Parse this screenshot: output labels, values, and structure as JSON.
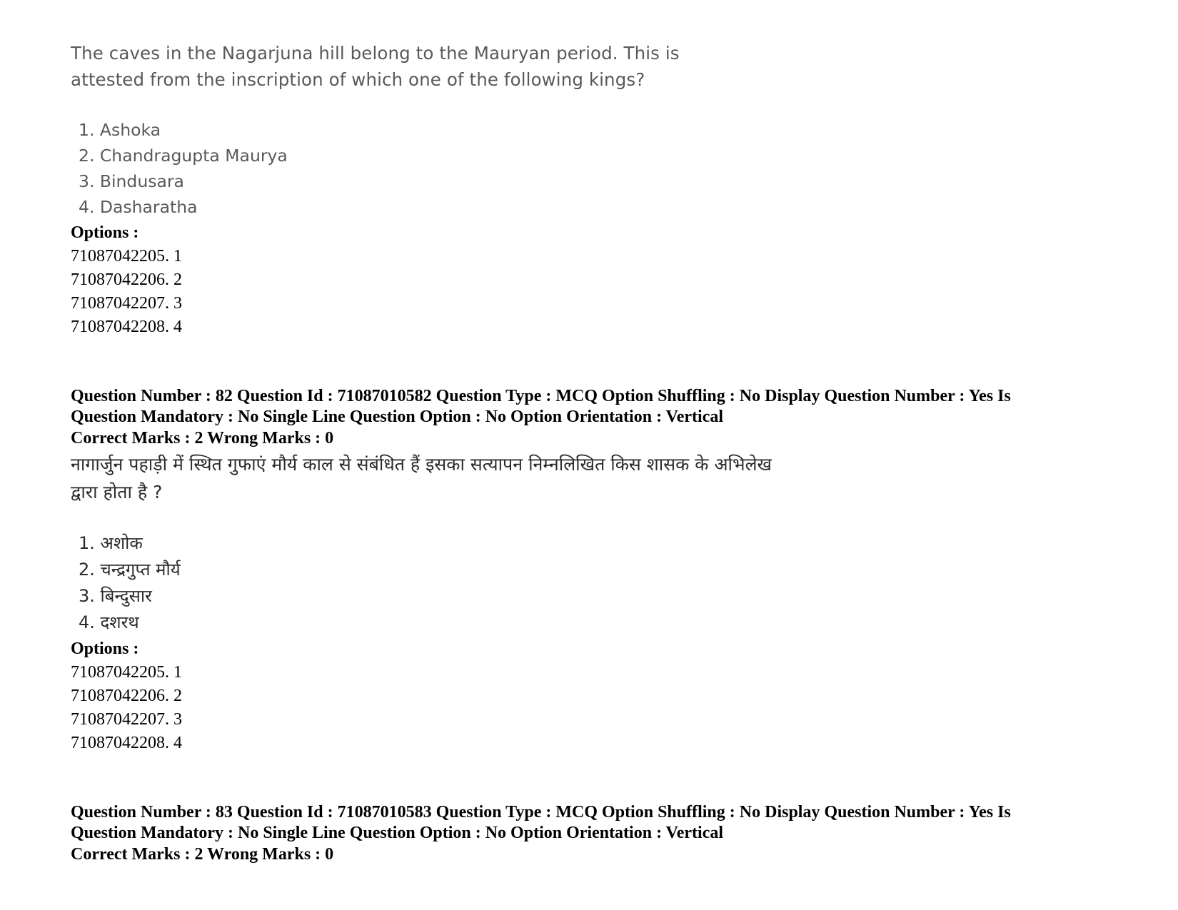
{
  "document": {
    "page_background": "#ffffff",
    "text_color_body": "#58595b",
    "text_color_meta": "#000000"
  },
  "question_en": {
    "stem": "The caves in the Nagarjuna hill belong to the Mauryan period. This is attested from the inscription of which one of the following kings?",
    "choices": [
      "1. Ashoka",
      "2. Chandragupta Maurya",
      "3. Bindusara",
      "4. Dasharatha"
    ],
    "options_label": "Options :",
    "option_ids": [
      "71087042205. 1",
      "71087042206. 2",
      "71087042207. 3",
      "71087042208. 4"
    ]
  },
  "meta_82": {
    "line1": "Question Number : 82 Question Id : 71087010582 Question Type : MCQ Option Shuffling : No Display Question Number : Yes Is Question Mandatory : No Single Line Question Option : No Option Orientation : Vertical",
    "line2": "Correct Marks : 2 Wrong Marks : 0",
    "question_number": "82",
    "question_id": "71087010582",
    "question_type": "MCQ",
    "option_shuffling": "No",
    "display_question_number": "Yes",
    "is_question_mandatory": "No",
    "single_line_question_option": "No",
    "option_orientation": "Vertical",
    "correct_marks": "2",
    "wrong_marks": "0"
  },
  "question_hi": {
    "stem_line1": "नागार्जुन पहाड़ी में स्थित गुफाएं मौर्य काल से संबंधित हैं इसका सत्यापन निम्नलिखित किस शासक के अभिलेख",
    "stem_line2": "द्वारा होता है ?",
    "choices": [
      "1. अशोक",
      "2. चन्द्रगुप्त मौर्य",
      "3. बिन्दुसार",
      "4. दशरथ"
    ],
    "options_label": "Options :",
    "option_ids": [
      "71087042205. 1",
      "71087042206. 2",
      "71087042207. 3",
      "71087042208. 4"
    ]
  },
  "meta_83": {
    "line1": "Question Number : 83 Question Id : 71087010583 Question Type : MCQ Option Shuffling : No Display Question Number : Yes Is Question Mandatory : No Single Line Question Option : No Option Orientation : Vertical",
    "line2": "Correct Marks : 2 Wrong Marks : 0",
    "question_number": "83",
    "question_id": "71087010583",
    "question_type": "MCQ",
    "option_shuffling": "No",
    "display_question_number": "Yes",
    "is_question_mandatory": "No",
    "single_line_question_option": "No",
    "option_orientation": "Vertical",
    "correct_marks": "2",
    "wrong_marks": "0"
  }
}
